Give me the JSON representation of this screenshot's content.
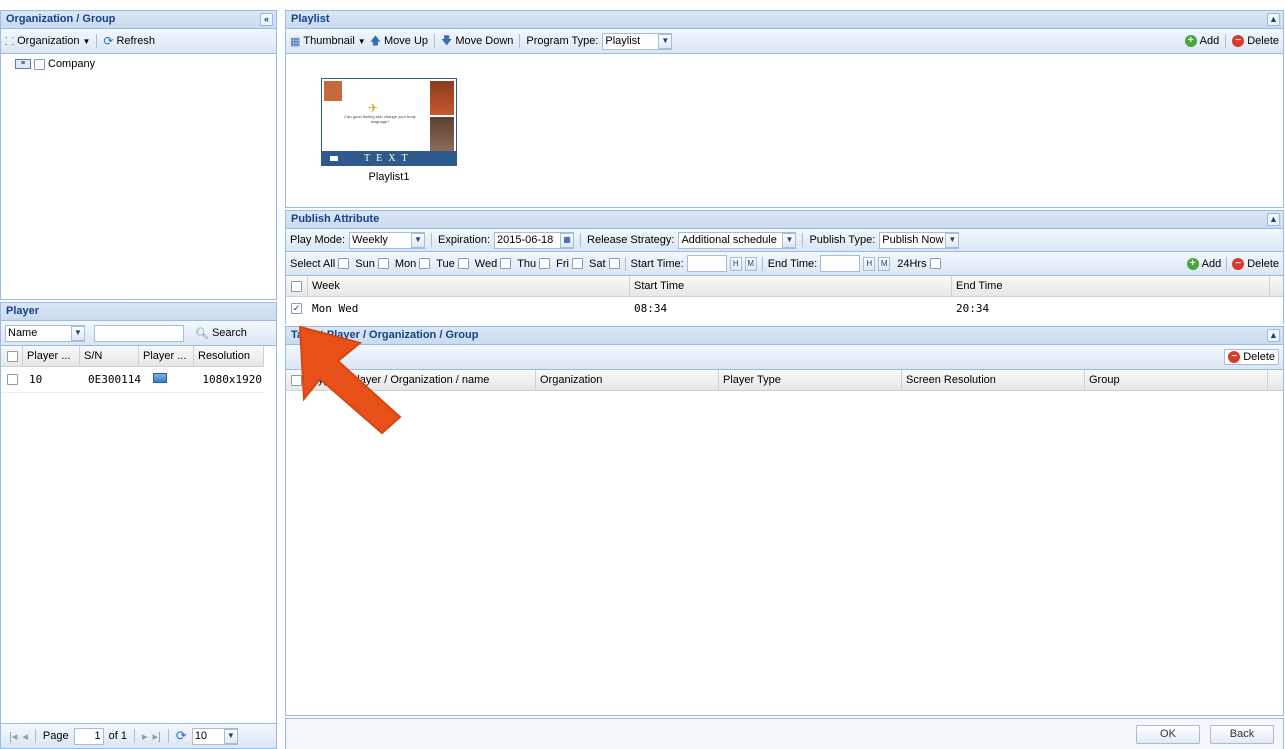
{
  "left": {
    "org_panel_title": "Organization / Group",
    "org_button": "Organization",
    "refresh_button": "Refresh",
    "tree_root": "Company",
    "player_panel_title": "Player",
    "search_field_value": "Name",
    "search_button": "Search",
    "columns": [
      "Player ...",
      "S/N",
      "Player ...",
      "Resolution"
    ],
    "rows": [
      {
        "player": "10",
        "sn": "0E300114",
        "resolution": "1080x1920"
      }
    ],
    "pager": {
      "page_label": "Page",
      "page_value": "1",
      "of_label": "of 1",
      "page_size": "10"
    }
  },
  "playlist": {
    "title": "Playlist",
    "thumbnail_button": "Thumbnail",
    "move_up": "Move Up",
    "move_down": "Move Down",
    "program_type_label": "Program Type:",
    "program_type_value": "Playlist",
    "add": "Add",
    "delete": "Delete",
    "thumb_text": "TEXT",
    "thumb_caption": "Can good feeling skin change your body language?",
    "item_name": "Playlist1"
  },
  "publish": {
    "title": "Publish Attribute",
    "play_mode_label": "Play Mode:",
    "play_mode_value": "Weekly",
    "expiration_label": "Expiration:",
    "expiration_value": "2015-06-18",
    "release_label": "Release Strategy:",
    "release_value": "Additional schedule",
    "publish_type_label": "Publish Type:",
    "publish_type_value": "Publish Now",
    "select_all": "Select All",
    "days": [
      "Sun",
      "Mon",
      "Tue",
      "Wed",
      "Thu",
      "Fri",
      "Sat"
    ],
    "start_time_label": "Start Time:",
    "end_time_label": "End Time:",
    "hrs_label": "24Hrs",
    "add": "Add",
    "delete": "Delete",
    "columns": [
      "Week",
      "Start Time",
      "End Time"
    ],
    "rows": [
      {
        "week": "Mon Wed",
        "start": "08:34",
        "end": "20:34"
      }
    ]
  },
  "target": {
    "title": "Target Player / Organization / Group",
    "delete": "Delete",
    "columns": [
      "Type",
      "Player / Organization / name",
      "Organization",
      "Player Type",
      "Screen Resolution",
      "Group"
    ]
  },
  "footer": {
    "ok": "OK",
    "back": "Back"
  },
  "colors": {
    "header_text": "#15428b",
    "border": "#99bbe8",
    "arrow": "#e8501a"
  }
}
